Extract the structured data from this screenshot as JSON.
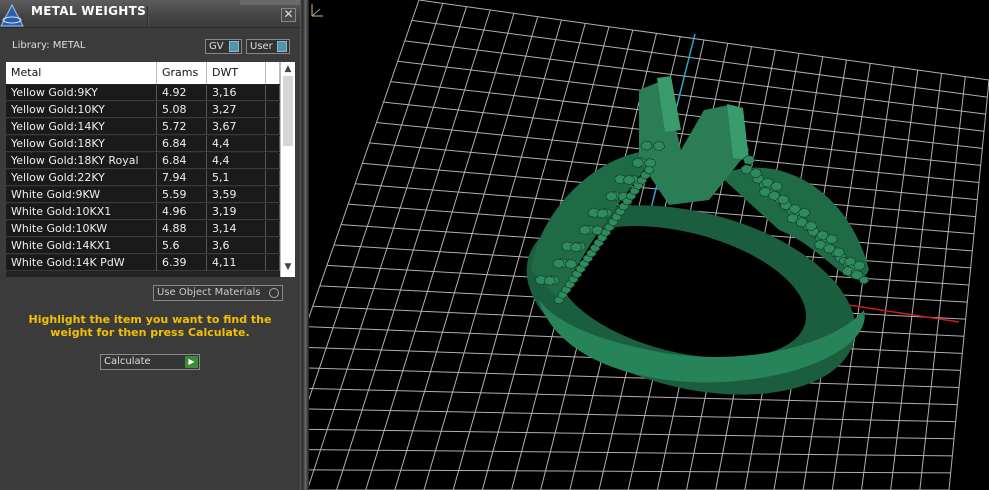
{
  "panel": {
    "title": "METAL WEIGHTS",
    "close_label": "✕",
    "library_label": "Library: METAL",
    "gv_label": "GV",
    "user_label": "User"
  },
  "table": {
    "headers": [
      "Metal",
      "Grams",
      "DWT"
    ],
    "rows": [
      {
        "metal": "Yellow Gold:9KY",
        "grams": "4.92",
        "dwt": "3,16"
      },
      {
        "metal": "Yellow Gold:10KY",
        "grams": "5.08",
        "dwt": "3,27"
      },
      {
        "metal": "Yellow Gold:14KY",
        "grams": "5.72",
        "dwt": "3,67"
      },
      {
        "metal": "Yellow Gold:18KY",
        "grams": "6.84",
        "dwt": "4,4"
      },
      {
        "metal": "Yellow Gold:18KY Royal",
        "grams": "6.84",
        "dwt": "4,4"
      },
      {
        "metal": "Yellow Gold:22KY",
        "grams": "7.94",
        "dwt": "5,1"
      },
      {
        "metal": "White Gold:9KW",
        "grams": "5.59",
        "dwt": "3,59"
      },
      {
        "metal": "White Gold:10KX1",
        "grams": "4.96",
        "dwt": "3,19"
      },
      {
        "metal": "White Gold:10KW",
        "grams": "4.88",
        "dwt": "3,14"
      },
      {
        "metal": "White Gold:14KX1",
        "grams": "5.6",
        "dwt": "3,6"
      },
      {
        "metal": "White Gold:14K PdW",
        "grams": "6.39",
        "dwt": "4,11"
      }
    ]
  },
  "use_object_materials_label": "Use Object Materials",
  "hint_text": "Highlight the item you want to find the weight for then press Calculate.",
  "calculate_label": "Calculate",
  "colors": {
    "hint": "#f2c200",
    "ring_green": "#1f6b48",
    "grid": "#cfcfcf",
    "x_axis": "#c81e1e",
    "z_axis": "#2aa9c9"
  }
}
